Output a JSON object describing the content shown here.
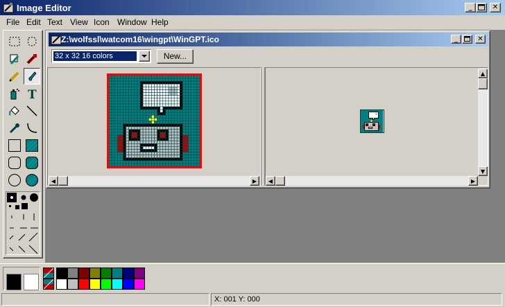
{
  "app": {
    "title": "Image Editor",
    "menu": [
      "File",
      "Edit",
      "Text",
      "View",
      "Icon",
      "Window",
      "Help"
    ]
  },
  "caption_buttons": {
    "minimize": "_",
    "restore": "❐",
    "close": "✕"
  },
  "document": {
    "title": "Z:\\wolfssl\\watcom16\\wingpt\\WinGPT.ico",
    "format_selected": "32 x 32  16 colors",
    "new_button": "New..."
  },
  "tools": [
    "select-rect-icon",
    "select-lasso-icon",
    "eyedropper-icon",
    "fill-icon",
    "pencil-icon",
    "brush-icon",
    "airbrush-icon",
    "text-icon",
    "paint-can-icon",
    "line-icon",
    "color-picker-icon",
    "curve-icon",
    "rectangle-outline-icon",
    "rectangle-filled-icon",
    "rounded-rect-outline-icon",
    "rounded-rect-filled-icon",
    "ellipse-outline-icon",
    "ellipse-filled-icon"
  ],
  "palette": {
    "top_row": [
      "#000000",
      "#808080",
      "#800000",
      "#808000",
      "#008000",
      "#008080",
      "#000080",
      "#800080"
    ],
    "bottom_row": [
      "#ffffff",
      "#c0c0c0",
      "#ff0000",
      "#ffff00",
      "#00ff00",
      "#00ffff",
      "#0000ff",
      "#ff00ff"
    ],
    "foreground": "#000000",
    "background": "#ffffff"
  },
  "status": {
    "coords": "X: 001  Y: 000"
  }
}
